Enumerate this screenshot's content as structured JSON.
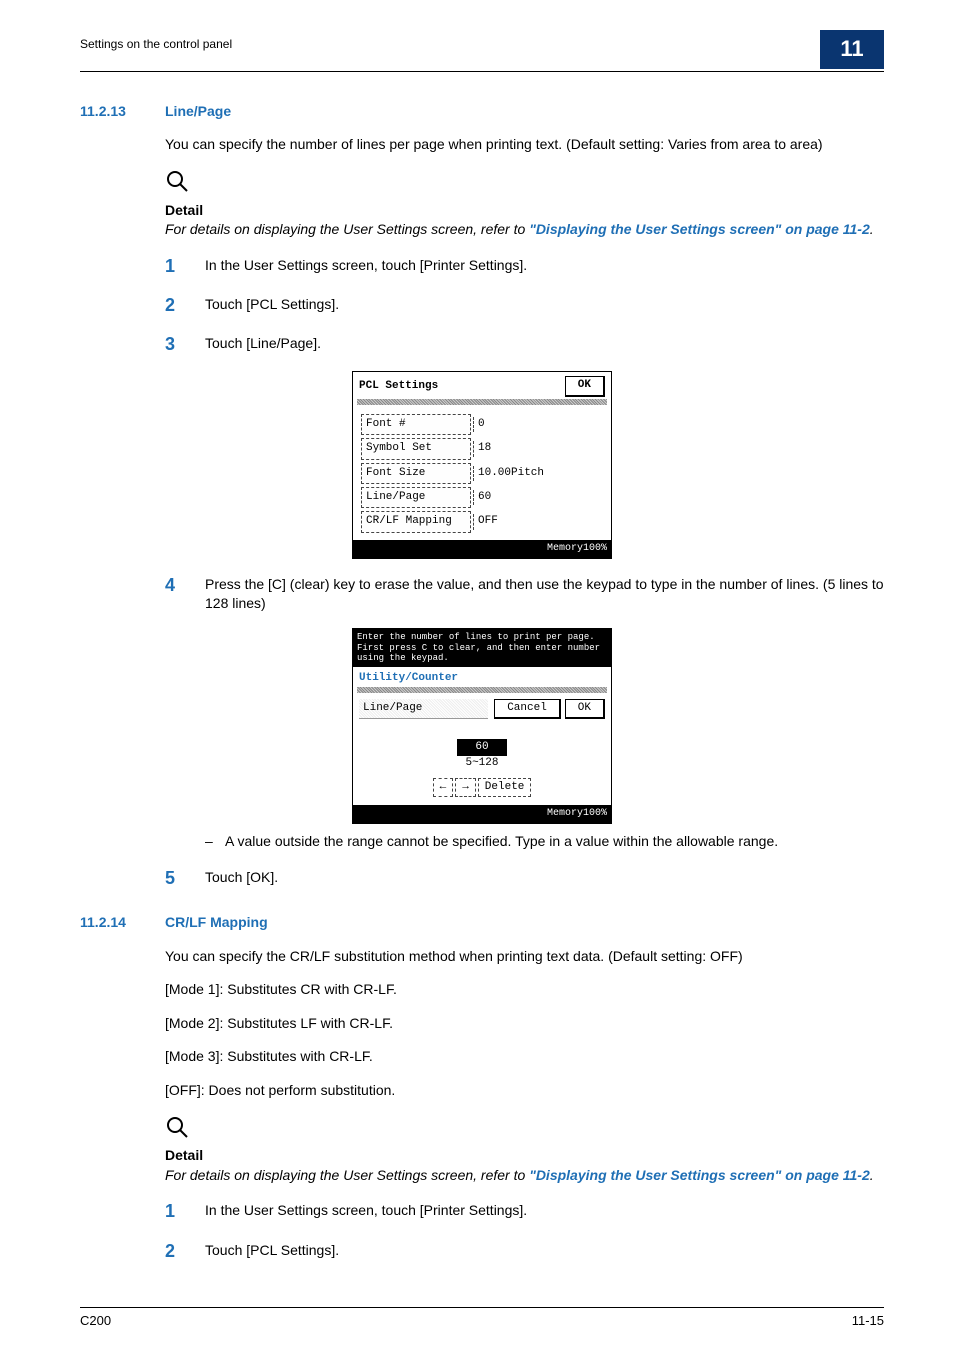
{
  "header": {
    "running": "Settings on the control panel",
    "chapter": "11"
  },
  "s1": {
    "num": "11.2.13",
    "title": "Line/Page",
    "intro": "You can specify the number of lines per page when printing text. (Default setting: Varies from area to area)",
    "detail_label": "Detail",
    "detail_text": "For details on displaying the User Settings screen, refer to ",
    "link": "\"Displaying the User Settings screen\" on page 11-2",
    "period": ".",
    "steps": {
      "s1": "In the User Settings screen, touch [Printer Settings].",
      "s2": "Touch [PCL Settings].",
      "s3": "Touch [Line/Page].",
      "s4": "Press the [C] (clear) key to erase the value, and then use the keypad to type in the number of lines. (5 lines to 128 lines)",
      "s4_note": "A value outside the range cannot be specified. Type in a value within the allowable range.",
      "s5": "Touch [OK]."
    }
  },
  "lcd1": {
    "title": "PCL Settings",
    "ok": "OK",
    "rows": {
      "r1l": "Font #",
      "r1v": "0",
      "r2l": "Symbol Set",
      "r2v": "18",
      "r3l": "Font Size",
      "r3v": "10.00Pitch",
      "r4l": "Line/Page",
      "r4v": "60",
      "r5l": "CR/LF Mapping",
      "r5v": "OFF"
    },
    "mem": "Memory100%"
  },
  "lcd2": {
    "top": "Enter the number of lines to print per page. First press C to clear, and then enter number using the keypad.",
    "utility": "Utility/Counter",
    "sub": "Line/Page",
    "cancel": "Cancel",
    "ok": "OK",
    "value": "60",
    "range": "5~128",
    "arrow_l": "←",
    "arrow_r": "→",
    "del": "Delete",
    "mem": "Memory100%"
  },
  "s2": {
    "num": "11.2.14",
    "title": "CR/LF Mapping",
    "intro": "You can specify the CR/LF substitution method when printing text data. (Default setting: OFF)",
    "m1": "[Mode 1]: Substitutes CR with CR-LF.",
    "m2": "[Mode 2]: Substitutes LF with CR-LF.",
    "m3": "[Mode 3]: Substitutes with CR-LF.",
    "off": "[OFF]: Does not perform substitution.",
    "detail_label": "Detail",
    "detail_text": "For details on displaying the User Settings screen, refer to ",
    "link": "\"Displaying the User Settings screen\" on page 11-2",
    "period": ".",
    "steps": {
      "s1": "In the User Settings screen, touch [Printer Settings].",
      "s2": "Touch [PCL Settings]."
    }
  },
  "footer": {
    "left": "C200",
    "right": "11-15"
  }
}
